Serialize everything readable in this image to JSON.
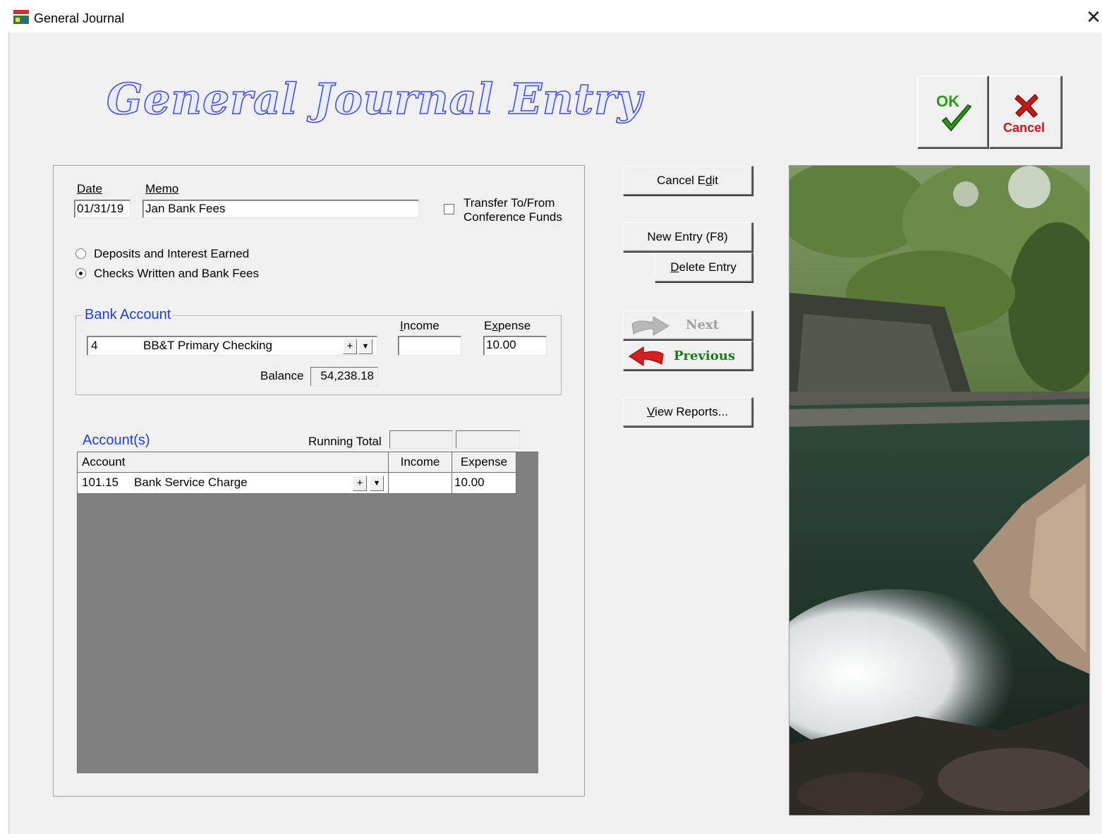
{
  "window": {
    "title": "General Journal",
    "close_glyph": "✕",
    "app_icon": "journal-app-icon"
  },
  "banner": {
    "title": "General Journal Entry"
  },
  "toolbar": {
    "ok_label": "OK",
    "cancel_label": "Cancel",
    "ok_icon": "green-checkmark-icon",
    "cancel_icon": "red-x-icon"
  },
  "form": {
    "date_label": "Date",
    "date_value": "01/31/19",
    "memo_label": "Memo",
    "memo_value": "Jan Bank Fees",
    "transfer_label_line1": "Transfer To/From",
    "transfer_label_line2": "Conference Funds",
    "transfer_checked": false,
    "radio_deposits_label": "Deposits and Interest Earned",
    "radio_checks_label": "Checks Written and Bank Fees",
    "selected_radio": "checks"
  },
  "bank_account": {
    "group_title": "Bank Account",
    "number": "4",
    "name": "BB&T Primary Checking",
    "income_label": "Income",
    "income_value": "",
    "expense_label": "Expense",
    "expense_value": "10.00",
    "balance_label": "Balance",
    "balance_value": "54,238.18",
    "plus_glyph": "+",
    "dropdown_glyph": "▼"
  },
  "accounts": {
    "title": "Account(s)",
    "running_total_label": "Running Total",
    "running_income": "",
    "running_expense": "",
    "columns": [
      "Account",
      "Income",
      "Expense"
    ],
    "rows": [
      {
        "number": "101.15",
        "name": "Bank Service Charge",
        "income": "",
        "expense": "10.00"
      }
    ]
  },
  "actions": {
    "cancel_edit": "Cancel Edit",
    "new_entry": "New Entry (F8)",
    "delete_entry": "Delete Entry",
    "next": "Next",
    "previous": "Previous",
    "view_reports": "View Reports...",
    "next_enabled": false,
    "next_icon": "gray-arrow-right-icon",
    "previous_icon": "red-arrow-left-icon"
  },
  "image": {
    "subject": "waterfall-pool-photo"
  },
  "colors": {
    "banner_outline": "#4552d6",
    "group_title": "#1f3fcf",
    "previous_text": "#1a7a1a",
    "ok_green": "#2e9b1e",
    "cancel_red": "#c81818",
    "grid_background": "#808080"
  }
}
